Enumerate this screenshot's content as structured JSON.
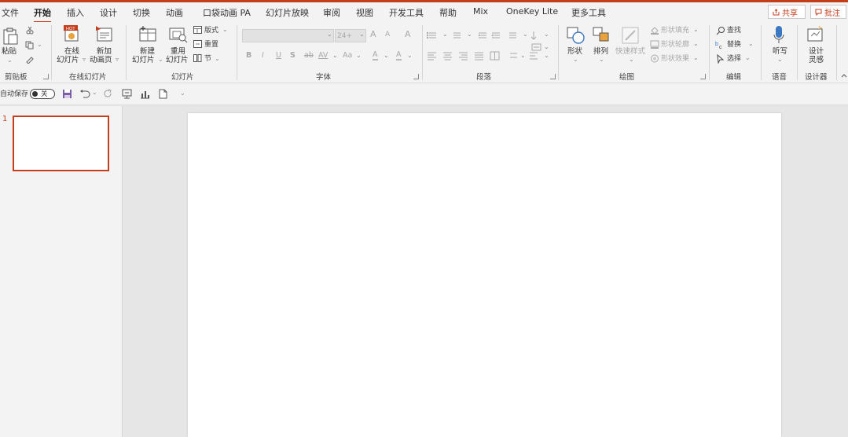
{
  "menu": {
    "tabs": [
      "文件",
      "开始",
      "插入",
      "设计",
      "切换",
      "动画",
      "口袋动画 PA",
      "幻灯片放映",
      "审阅",
      "视图",
      "开发工具",
      "帮助",
      "Mix",
      "OneKey Lite",
      "更多工具"
    ],
    "share_label": "共享",
    "comment_label": "批注"
  },
  "ribbon": {
    "clipboard": {
      "paste": "粘贴",
      "group": "剪贴板"
    },
    "online_slides": {
      "online": "在线",
      "online2": "幻灯片",
      "new_anim": "新加",
      "new_anim2": "动画页",
      "group": "在线幻灯片",
      "hot_badge": "HOT"
    },
    "slides": {
      "new": "新建",
      "new2": "幻灯片",
      "reuse": "重用",
      "reuse2": "幻灯片",
      "layout": "版式",
      "reset": "重置",
      "section": "节",
      "group": "幻灯片"
    },
    "font": {
      "size": "24+",
      "bold": "B",
      "italic": "I",
      "underline": "U",
      "shadow": "S",
      "strike": "ab",
      "spacing": "AV",
      "case": "Aa",
      "grow": "A",
      "shrink": "A",
      "clear": "A",
      "highlight": "A",
      "color": "A",
      "group": "字体"
    },
    "paragraph": {
      "group": "段落"
    },
    "drawing": {
      "shape": "形状",
      "arrange": "排列",
      "quick_styles": "快速样式",
      "fill": "形状填充",
      "outline": "形状轮廓",
      "effects": "形状效果",
      "group": "绘图"
    },
    "editing": {
      "find": "查找",
      "replace": "替换",
      "select": "选择",
      "group": "编辑"
    },
    "voice": {
      "dictate": "听写",
      "group": "语音"
    },
    "designer": {
      "design": "设计",
      "design2": "灵感",
      "group": "设计器"
    }
  },
  "qat": {
    "autosave": "自动保存",
    "toggle_state": "关"
  },
  "slides_panel": {
    "numbers": [
      "1"
    ]
  },
  "colors": {
    "accent": "#c43e1c",
    "ribbon_bg": "#f3f3f3",
    "canvas_bg": "#e6e6e6"
  }
}
